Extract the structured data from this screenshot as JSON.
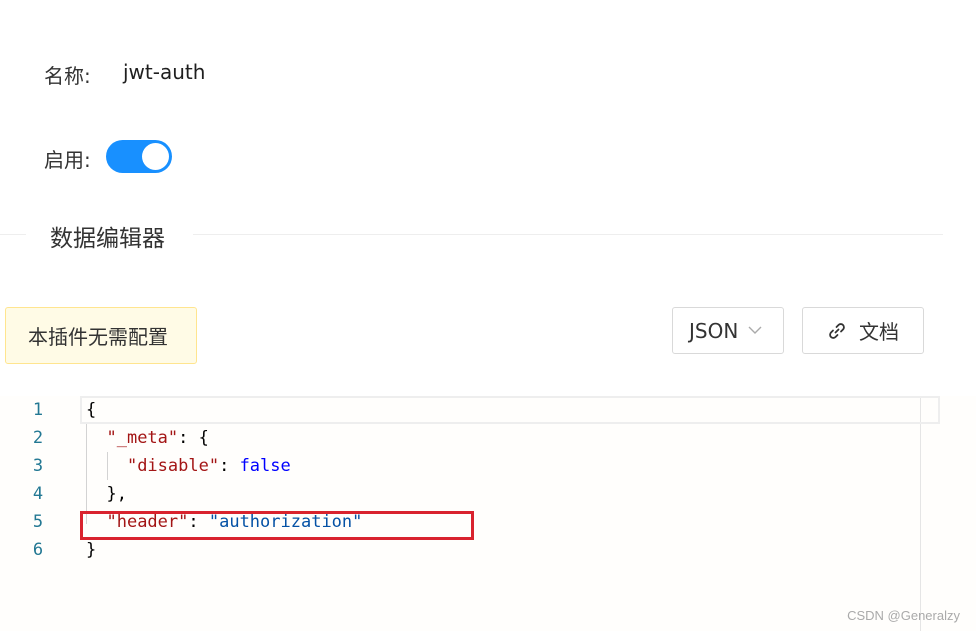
{
  "form": {
    "name_label": "名称:",
    "name_value": "jwt-auth",
    "enable_label": "启用:",
    "enable_state": true
  },
  "section": {
    "title": "数据编辑器"
  },
  "notice": {
    "text": "本插件无需配置"
  },
  "toolbar": {
    "format_select": "JSON",
    "docs_label": "文档",
    "docs_icon": "link-icon"
  },
  "editor": {
    "line_numbers": [
      "1",
      "2",
      "3",
      "4",
      "5",
      "6"
    ],
    "lines": [
      {
        "tokens": [
          {
            "t": "{",
            "c": "punct"
          }
        ]
      },
      {
        "tokens": [
          {
            "t": "  ",
            "c": "punct"
          },
          {
            "t": "\"_meta\"",
            "c": "key"
          },
          {
            "t": ": {",
            "c": "punct"
          }
        ]
      },
      {
        "tokens": [
          {
            "t": "    ",
            "c": "punct"
          },
          {
            "t": "\"disable\"",
            "c": "key"
          },
          {
            "t": ": ",
            "c": "punct"
          },
          {
            "t": "false",
            "c": "bool"
          }
        ]
      },
      {
        "tokens": [
          {
            "t": "  },",
            "c": "punct"
          }
        ]
      },
      {
        "tokens": [
          {
            "t": "  ",
            "c": "punct"
          },
          {
            "t": "\"header\"",
            "c": "key"
          },
          {
            "t": ": ",
            "c": "punct"
          },
          {
            "t": "\"authorization\"",
            "c": "str"
          }
        ]
      },
      {
        "tokens": [
          {
            "t": "}",
            "c": "punct"
          }
        ]
      }
    ]
  },
  "colors": {
    "accent": "#1890ff",
    "highlight_box": "#d9232e",
    "notice_bg": "#fffbe6"
  },
  "watermark": "CSDN @Generalzy"
}
